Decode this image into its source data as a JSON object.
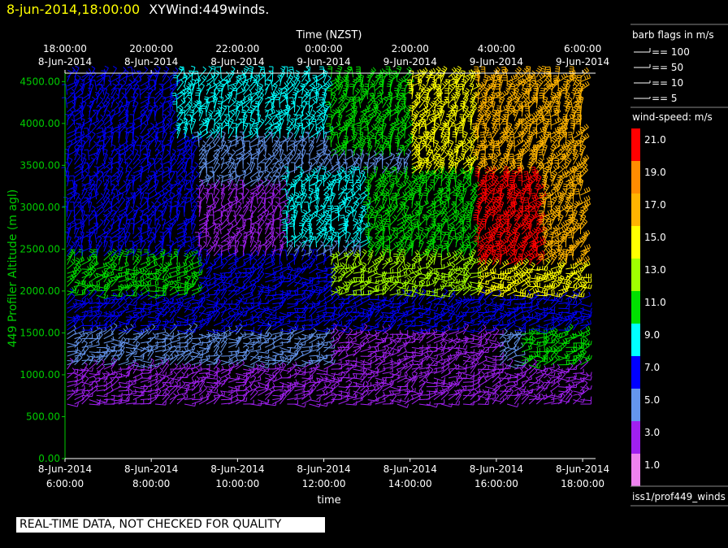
{
  "title": {
    "timestamp": "8-jun-2014,18:00:00",
    "name": "XYWind:449winds."
  },
  "qc_banner": "REAL-TIME DATA, NOT CHECKED FOR QUALITY",
  "colors": {
    "timestamp": "#ffff00",
    "axis_green": "#00cc00",
    "background": "#000000"
  },
  "chart_data": {
    "type": "wind-barb",
    "top_axis": {
      "label": "Time (NZST)",
      "ticks": [
        {
          "time": "18:00:00",
          "date": "8-Jun-2014"
        },
        {
          "time": "20:00:00",
          "date": "8-Jun-2014"
        },
        {
          "time": "22:00:00",
          "date": "8-Jun-2014"
        },
        {
          "time": "0:00:00",
          "date": "9-Jun-2014"
        },
        {
          "time": "2:00:00",
          "date": "9-Jun-2014"
        },
        {
          "time": "4:00:00",
          "date": "9-Jun-2014"
        },
        {
          "time": "6:00:00",
          "date": "9-Jun-2014"
        }
      ]
    },
    "bottom_axis": {
      "label": "time",
      "ticks": [
        {
          "date": "8-Jun-2014",
          "time": "6:00:00"
        },
        {
          "date": "8-Jun-2014",
          "time": "8:00:00"
        },
        {
          "date": "8-Jun-2014",
          "time": "10:00:00"
        },
        {
          "date": "8-Jun-2014",
          "time": "12:00:00"
        },
        {
          "date": "8-Jun-2014",
          "time": "14:00:00"
        },
        {
          "date": "8-Jun-2014",
          "time": "16:00:00"
        },
        {
          "date": "8-Jun-2014",
          "time": "18:00:00"
        }
      ]
    },
    "y_axis": {
      "label": "449 Profiler Altitude (m agl)",
      "ticks": [
        "4500.00",
        "4000.00",
        "3500.00",
        "3000.00",
        "2500.00",
        "2000.00",
        "1500.00",
        "1000.00",
        "500.00",
        "0.00"
      ],
      "range": [
        0,
        4600
      ]
    },
    "x_range_hours": [
      0,
      12.3
    ],
    "barb_legend": {
      "title": "barb flags in m/s",
      "items": [
        "== 100",
        "== 50",
        "== 10",
        "== 5"
      ]
    },
    "colorbar": {
      "title": "wind-speed: m/s",
      "bins": [
        {
          "label": "21.0",
          "color": "#ff0000"
        },
        {
          "label": "19.0",
          "color": "#ff8c00"
        },
        {
          "label": "17.0",
          "color": "#ffb400"
        },
        {
          "label": "15.0",
          "color": "#ffff00"
        },
        {
          "label": "13.0",
          "color": "#a0ff00"
        },
        {
          "label": "11.0",
          "color": "#00e000"
        },
        {
          "label": "9.0",
          "color": "#00ffff"
        },
        {
          "label": "7.0",
          "color": "#0000ff"
        },
        {
          "label": "5.0",
          "color": "#6495ed"
        },
        {
          "label": "3.0",
          "color": "#a020f0"
        },
        {
          "label": "1.0",
          "color": "#ee82ee"
        }
      ]
    },
    "source_label": "iss1/prof449_winds",
    "speed_field": {
      "description_units": "m/s",
      "regions": [
        {
          "t": [
            0,
            3
          ],
          "z": [
            3600,
            4600
          ],
          "speed": 7
        },
        {
          "t": [
            2.5,
            6
          ],
          "z": [
            3800,
            4600
          ],
          "speed": 9
        },
        {
          "t": [
            6,
            8
          ],
          "z": [
            3600,
            4600
          ],
          "speed": 11
        },
        {
          "t": [
            8,
            9.5
          ],
          "z": [
            3400,
            4600
          ],
          "speed": 15
        },
        {
          "t": [
            9.5,
            12
          ],
          "z": [
            3400,
            4600
          ],
          "speed": 17
        },
        {
          "t": [
            9.5,
            11
          ],
          "z": [
            2300,
            3400
          ],
          "speed": 21
        },
        {
          "t": [
            11,
            12
          ],
          "z": [
            2300,
            3400
          ],
          "speed": 17
        },
        {
          "t": [
            0,
            3
          ],
          "z": [
            2400,
            3600
          ],
          "speed": 7
        },
        {
          "t": [
            3,
            5
          ],
          "z": [
            2400,
            3200
          ],
          "speed": 3
        },
        {
          "t": [
            5,
            8
          ],
          "z": [
            2500,
            3400
          ],
          "speed": 9
        },
        {
          "t": [
            7,
            9.5
          ],
          "z": [
            2400,
            3400
          ],
          "speed": 11
        },
        {
          "t": [
            0,
            3
          ],
          "z": [
            1900,
            2400
          ],
          "speed": 11
        },
        {
          "t": [
            3,
            6
          ],
          "z": [
            1900,
            2400
          ],
          "speed": 7
        },
        {
          "t": [
            6,
            9.5
          ],
          "z": [
            1900,
            2400
          ],
          "speed": 13
        },
        {
          "t": [
            9.5,
            12
          ],
          "z": [
            1900,
            2300
          ],
          "speed": 15
        },
        {
          "t": [
            0,
            12
          ],
          "z": [
            1500,
            1900
          ],
          "speed": 7
        },
        {
          "t": [
            6,
            10
          ],
          "z": [
            1100,
            1500
          ],
          "speed": 3
        },
        {
          "t": [
            10.5,
            12
          ],
          "z": [
            1100,
            1500
          ],
          "speed": 11
        },
        {
          "t": [
            0,
            12
          ],
          "z": [
            650,
            1100
          ],
          "speed": 3
        }
      ]
    }
  }
}
